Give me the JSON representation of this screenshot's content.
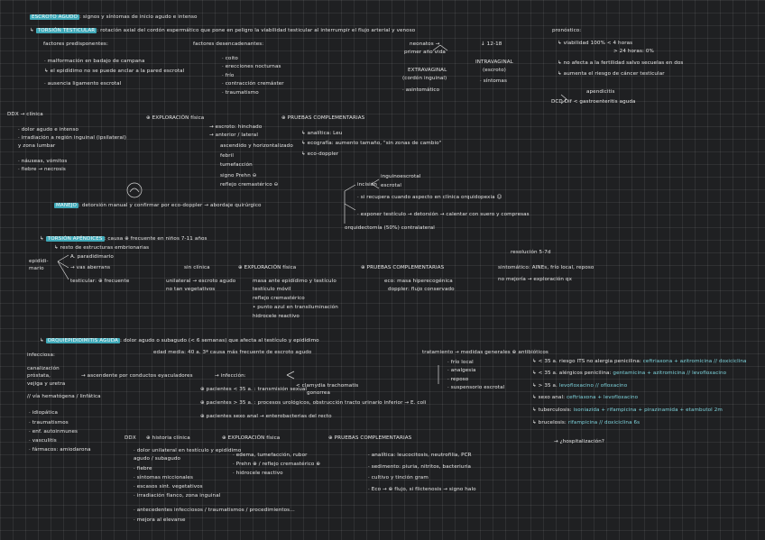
{
  "notes": {
    "title_tag": "ESCROTO AGUDO",
    "title_rest": ": signos y síntomas de inicio agudo e intenso",
    "torsion_tag": "TORSIÓN TESTICULAR",
    "torsion_def": ": rotación axial del cordón espermático que pone en peligro la viabilidad testicular al interrumpir el flujo arterial y venoso",
    "factores_pred": "factores predisponentes:",
    "factores_desenc": "factores desencadenantes:",
    "fp1": "· malformación en badajo de campana",
    "fp2": "↳ el epidídimo no se puede anclar a la pared escrotal",
    "fp3": "· ausencia ligamento escrotal",
    "fd1": "· coito",
    "fd2": "· erecciones nocturnas",
    "fd3": "· frío",
    "fd4": "· contracción cremáster",
    "fd5": "· traumatismo",
    "edad1": "neonatos →",
    "edad2": "primer año vida",
    "edad3": "EXTRAVAGINAL",
    "edad4": "(cordón inguinal)",
    "edad5": "· asintomático",
    "edad6": "↓ 12-18",
    "edad7": "INTRAVAGINAL",
    "edad8": "(escroto)",
    "edad9": "· síntomas",
    "pron_h": "pronóstico:",
    "pron1": "↳ viabilidad 100% < 4 horas",
    "pron2": "> 24 horas: 0%",
    "pron3": "↳ no afecta a la fertilidad salvo secuelas en dos",
    "pron4": "↳ aumenta el riesgo de cáncer testicular",
    "dd_h1": "apendicitis",
    "dd_h2": "DCD Dif < gastroenteritis aguda",
    "ddx": "DDX → clínica",
    "cl1": "· dolor agudo e intenso",
    "cl2": "· irradiación a región inguinal (ipsilateral)",
    "cl3": "y zona lumbar",
    "cl4": "· náuseas, vómitos",
    "cl5": "· fiebre → necrosis",
    "expl_h": "EXPLORACIÓN física",
    "ex1": "→ escroto: hinchado",
    "ex2": "→ anterior / lateral",
    "ex3": "ascendido y horizontalizado",
    "ex4": "febril",
    "ex5": "tumefacción",
    "ex6": "signo Prehn ⊖",
    "ex7": "reflejo cremastérico ⊖",
    "pc_h": "PRUEBAS COMPLEMENTARIAS",
    "pc1": "↳ analítica: Leu",
    "pc2": "↳ ecografía: aumento tamaño, \"sin zonas de cambio\"",
    "pc3": "↳ eco-doppler",
    "manejo_tag": "MANEJO",
    "manejo_txt": ": detorsión manual y confirmar por eco-doppler → abordaje quirúrgico",
    "q1": "inguinoescrotal",
    "q2": "incisión",
    "q3": "escrotal",
    "q4": "· si recupera cuando aspecto en clínica orquidopexia ☺",
    "q5": "· exponer testículo → detorsión → calentar con suero y compresas",
    "q6": "orquidectomía (50%) contralateral",
    "apend_tag": "TORSIÓN APÉNDICES",
    "apend_txt": ": causa ⊕ frecuente en niños 7-11 años",
    "ap1": "↳ resto de estructuras embrionarias",
    "ap2": "A. paradidimario",
    "epid1": "epidídi-",
    "epid2": "mario",
    "ap3": "→ vas aberrans",
    "ap4": "testicular: ⊕ frecuente",
    "ap_cl": "sin clínica",
    "ap_cl1": "unilateral → escroto agudo",
    "ap_cl2": "no tan vegetativos",
    "ap_ex": "EXPLORACIÓN física",
    "ap_ex1": "masa ante epidídimo y testículo",
    "ap_ex2": "testículo móvil",
    "ap_ex3": "reflejo cremastérico",
    "ap_ex4": "• punto azul en transiluminación",
    "ap_ex5": "hidrocele reactivo",
    "ap_pc": "PRUEBAS COMPLEMENTARIAS",
    "ap_pc1": "eco: masa hiperecogénica",
    "ap_pc2": "doppler: flujo conservado",
    "ap_res_h": "resolución 5-7d",
    "ap_res1": "sintomático: AINEs, frío local, reposo",
    "ap_res2": "no mejoría → exploración qx",
    "orq_tag": "ORQUIEPIDIDIMITIS AGUDA",
    "orq_def": ": dolor agudo o subagudo (< 6 semanas) que afecta al testículo y epidídimo",
    "orq_edad": "edad media: 40 a. 3ª causa más frecuente de escroto agudo",
    "inf_h": "infecciosa:",
    "inf1": "canalización",
    "inf2": "próstata,",
    "inf3": "vejiga y uretra",
    "inf4": "→ ascendente por conductos eyaculadores",
    "inf5": "// vía hematógena / linfática",
    "inf6": "→ infección:",
    "pac1": "⊕ pacientes < 35 a. : transmisión sexual",
    "pac1b": "< clamydia trachomatis",
    "pac1c": "gonorrea",
    "pac2": "⊕ pacientes > 35 a. : procesos urológicos, obstrucción tracto urinario inferior → E. coli",
    "pac3": "⊕ pacientes sexo anal → enterobacterias del recto",
    "nc1": "· idiopática",
    "nc2": "· traumatismos",
    "nc3": "· enf. autoinmunes",
    "nc4": "· vasculitis",
    "nc5": "· fármacos: amiodarona",
    "tto_h": "tratamiento → medidas generales ⊕ antibióticos",
    "tto_m1": "· frío local",
    "tto_m2": "· analgesia",
    "tto_m3": "· reposo",
    "tto_m4": "· suspensorio escrotal",
    "ab1_a": "↳ < 35 a. riesgo ITS no alergia penicilina:",
    "ab1_b": "ceftriaxona + azitromicina // doxiciclina",
    "ab2_a": "↳ < 35 a. alérgicos penicilina:",
    "ab2_b": "gentamicina + azitromicina // levofloxacino",
    "ab3_a": "↳ > 35 a.",
    "ab3_b": "levofloxacino // ofloxacino",
    "ab4_a": "↳ sexo anal:",
    "ab4_b": "ceftriaxona + levofloxacino",
    "ab5_a": "↳ tuberculosis:",
    "ab5_b": "isoniazida + rifampicina + pirazinamida + etambutol 2m",
    "ab6_a": "↳ brucelosis:",
    "ab6_b": "rifampicina // doxiciclina 6s",
    "hosp": "→ ¿hospitalización?",
    "o_ddx": "DDX",
    "o_hc": "historia clínica",
    "o_hc1": "· dolor unilateral en testículo y epidídimo",
    "o_hc2": "agudo / subagudo",
    "o_hc3": "· fiebre",
    "o_hc4": "· síntomas miccionales",
    "o_hc5": "· escasos sint. vegetativos",
    "o_hc6": "· irradiación flanco, zona inguinal",
    "o_hc7": "· antecedentes infecciosos / traumatismos / procedimientos...",
    "o_hc8": "· mejora al elevarse",
    "o_ex": "EXPLORACIÓN física",
    "o_ex1": "· edema, tumefacción, rubor",
    "o_ex2": "· Prehn ⊕ / reflejo cremastérico ⊕",
    "o_ex3": "· hidrocele reactivo",
    "o_pc": "PRUEBAS COMPLEMENTARIAS",
    "o_pc1": "· analítica: leucocitosis, neutrofilia, PCR",
    "o_pc2": "· sedimento: piuria, nitritos, bacteriuria",
    "o_pc3": "· cultivo y tinción gram",
    "o_pc4": "· Eco → ⊕ flujo, si flictenosis → signo halo"
  }
}
